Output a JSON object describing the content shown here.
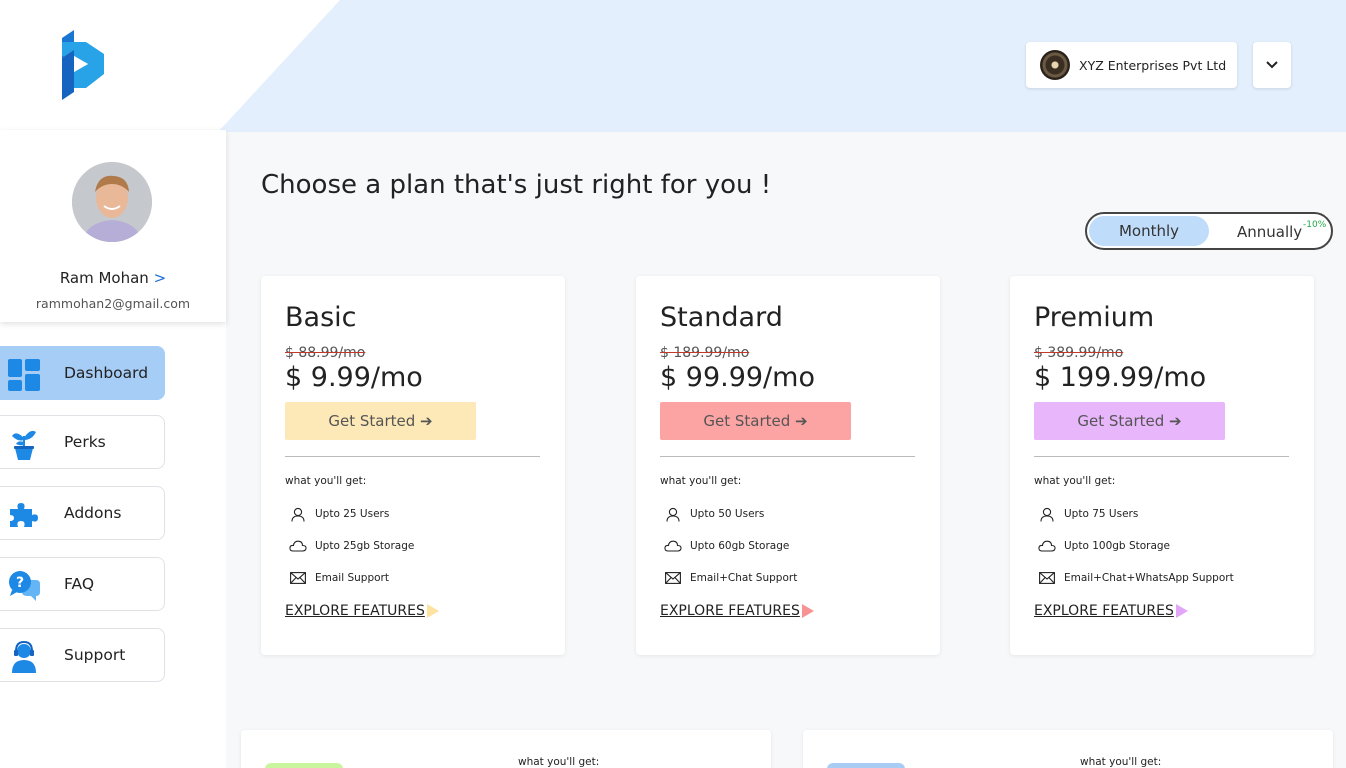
{
  "header": {
    "company_name": "XYZ Enterprises Pvt Ltd",
    "logo_icon": "brand-p-logo",
    "dropdown_icon": "chevron-down-icon"
  },
  "profile": {
    "name": "Ram Mohan",
    "arrow": ">",
    "email": "rammohan2@gmail.com"
  },
  "nav": {
    "items": [
      {
        "label": "Dashboard",
        "icon": "dashboard-icon",
        "active": true
      },
      {
        "label": "Perks",
        "icon": "plant-icon",
        "active": false
      },
      {
        "label": "Addons",
        "icon": "puzzle-icon",
        "active": false
      },
      {
        "label": "FAQ",
        "icon": "faq-chat-icon",
        "active": false
      },
      {
        "label": "Support",
        "icon": "support-agent-icon",
        "active": false
      }
    ]
  },
  "main": {
    "heading": "Choose a plan that's just right for you !",
    "billing_toggle": {
      "monthly": "Monthly",
      "annually": "Annually",
      "discount": "-10%",
      "selected": "Monthly"
    },
    "plans": [
      {
        "name": "Basic",
        "old_price": "$ 88.99/mo",
        "price": "$ 9.99/mo",
        "button": "Get Started ➔",
        "button_color": "#fde9b8",
        "accent_color": "#fde2a0",
        "includes_label": "what you'll get:",
        "features": [
          "Upto 25 Users",
          "Upto 25gb Storage",
          "Email Support"
        ],
        "explore": "EXPLORE FEATURES"
      },
      {
        "name": "Standard",
        "old_price": "$ 189.99/mo",
        "price": "$ 99.99/mo",
        "button": "Get Started ➔",
        "button_color": "#fca4a4",
        "accent_color": "#f69494",
        "includes_label": "what you'll get:",
        "features": [
          "Upto 50 Users",
          "Upto 60gb Storage",
          "Email+Chat Support"
        ],
        "explore": "EXPLORE FEATURES"
      },
      {
        "name": "Premium",
        "old_price": "$ 389.99/mo",
        "price": "$ 199.99/mo",
        "button": "Get Started ➔",
        "button_color": "#e8b6fb",
        "accent_color": "#e2a6f8",
        "includes_label": "what you'll get:",
        "features": [
          "Upto 75 Users",
          "Upto 100gb Storage",
          "Email+Chat+WhatsApp Support"
        ],
        "explore": "EXPLORE FEATURES"
      }
    ],
    "feature_icons": [
      "user-icon",
      "cloud-icon",
      "mail-icon"
    ],
    "bottom_cards": [
      {
        "includes_label": "what you'll get:",
        "pill_color": "#c9f59e"
      },
      {
        "includes_label": "what you'll get:",
        "pill_color": "#a9ccf4"
      }
    ]
  },
  "colors": {
    "banner": "#e3effd",
    "active_nav": "#a6cdf6",
    "brand_blue": "#1e88e5"
  }
}
